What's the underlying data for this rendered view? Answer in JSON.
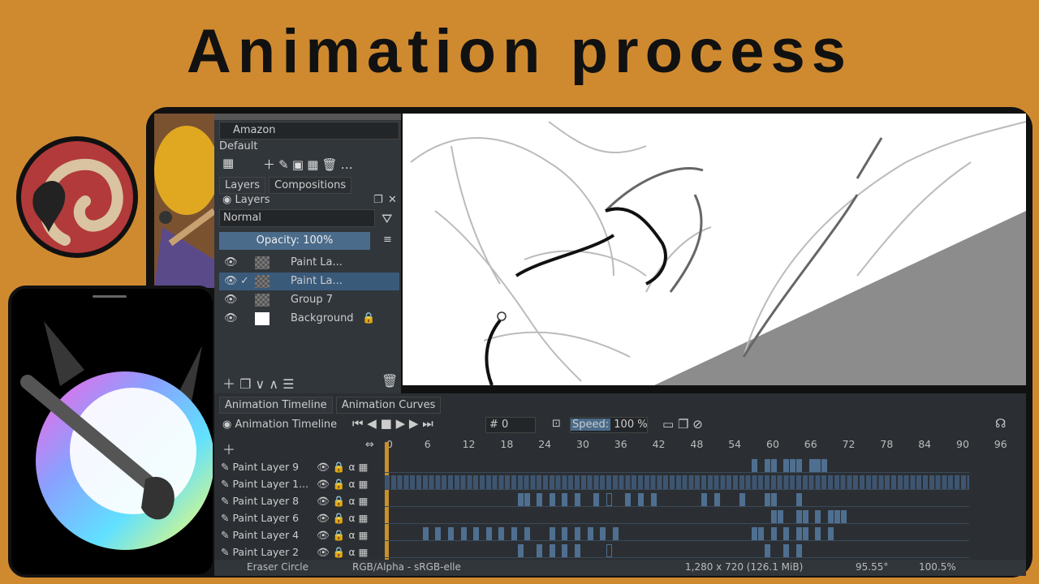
{
  "title": "Animation process",
  "krita": {
    "preset": "Amazon",
    "preset_group": "Default",
    "tabs": [
      "Layers",
      "Compositions"
    ],
    "docker_title": "Layers",
    "blend_mode": "Normal",
    "opacity": "Opacity: 100%",
    "layers": [
      {
        "name": "Paint La...",
        "selected": false,
        "thumb": "checker"
      },
      {
        "name": "Paint La...",
        "selected": true,
        "thumb": "checker"
      },
      {
        "name": "Group 7",
        "selected": false,
        "thumb": "checker"
      },
      {
        "name": "Background",
        "selected": false,
        "thumb": "white"
      }
    ],
    "timeline_tabs": [
      "Animation Timeline",
      "Animation Curves"
    ],
    "timeline_title": "Animation Timeline",
    "frame_field": "# 0",
    "speed_label": "Speed:",
    "speed_value": "100 %",
    "ruler": [
      "0",
      "6",
      "12",
      "18",
      "24",
      "30",
      "36",
      "42",
      "48",
      "54",
      "60",
      "66",
      "72",
      "78",
      "84",
      "90",
      "96"
    ],
    "tracks": [
      {
        "name": "Paint Layer 9",
        "keys": [
          58,
          60,
          61,
          63,
          64,
          65,
          67,
          68,
          69
        ],
        "hollow": []
      },
      {
        "name": "Paint Layer 1...",
        "keys": [],
        "hollow": []
      },
      {
        "name": "Paint Layer 8",
        "keys": [
          21,
          22,
          24,
          26,
          28,
          30,
          33,
          35,
          38,
          40,
          42,
          50,
          52,
          56,
          60,
          61,
          65
        ],
        "hollow": [
          35
        ]
      },
      {
        "name": "Paint Layer 6",
        "keys": [
          61,
          62,
          65,
          66,
          68,
          70,
          72,
          71
        ],
        "hollow": []
      },
      {
        "name": "Paint Layer 4",
        "keys": [
          6,
          8,
          10,
          12,
          14,
          16,
          18,
          20,
          22,
          26,
          28,
          30,
          32,
          34,
          36,
          58,
          59,
          61,
          63,
          65,
          66,
          68,
          70
        ],
        "hollow": []
      },
      {
        "name": "Paint Layer 2",
        "keys": [
          21,
          24,
          26,
          28,
          30,
          60,
          63,
          65
        ],
        "hollow": [
          35
        ]
      }
    ],
    "status": {
      "tool": "Eraser Circle",
      "color": "RGB/Alpha - sRGB-elle",
      "size": "1,280 x 720 (126.1 MiB)",
      "angle": "95.55°",
      "zoom": "100.5%"
    }
  }
}
